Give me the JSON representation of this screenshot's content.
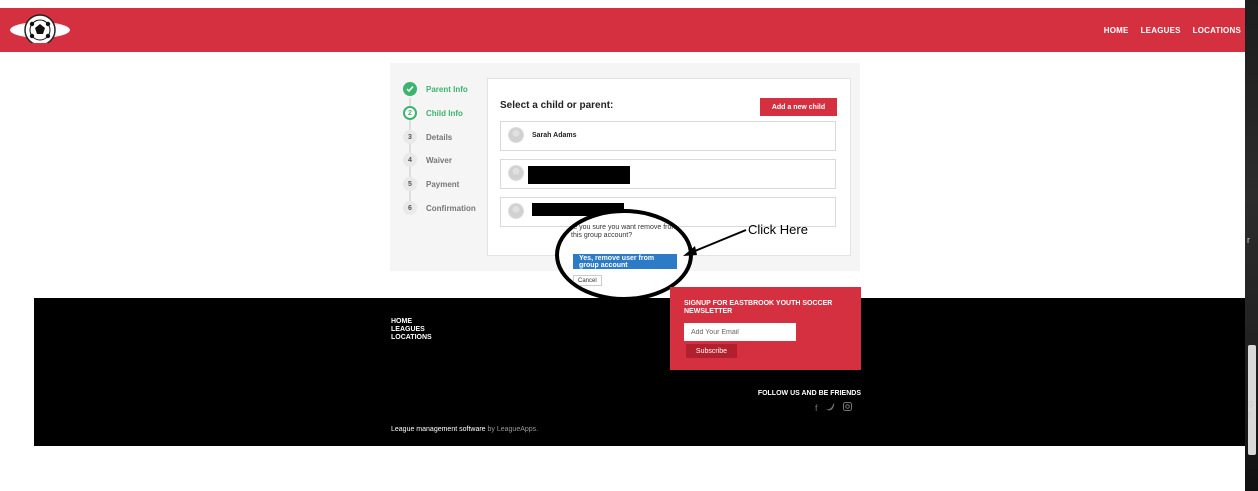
{
  "header": {
    "nav": [
      "HOME",
      "LEAGUES",
      "LOCATIONS"
    ],
    "brand_color": "#d4303f"
  },
  "steps": [
    {
      "num": "",
      "label": "Parent Info",
      "state": "done"
    },
    {
      "num": "2",
      "label": "Child Info",
      "state": "active"
    },
    {
      "num": "3",
      "label": "Details",
      "state": "todo"
    },
    {
      "num": "4",
      "label": "Waiver",
      "state": "todo"
    },
    {
      "num": "5",
      "label": "Payment",
      "state": "todo"
    },
    {
      "num": "6",
      "label": "Confirmation",
      "state": "todo"
    }
  ],
  "card": {
    "title": "Select a child or parent:",
    "add_button": "Add a new child",
    "rows": [
      {
        "name": "Sarah Adams",
        "redacted": false
      },
      {
        "name": "",
        "redacted": true
      },
      {
        "name": "",
        "redacted": true
      }
    ]
  },
  "dialog": {
    "text": "re you sure you want remove from this group account?",
    "confirm": "Yes, remove user from group account",
    "cancel": "Cancel"
  },
  "annotation": "Click Here",
  "footer": {
    "nav": [
      "HOME",
      "LEAGUES",
      "LOCATIONS"
    ],
    "newsletter_title": "SIGNUP FOR EASTBROOK YOUTH SOCCER NEWSLETTER",
    "email_placeholder": "Add Your Email",
    "subscribe": "Subscribe",
    "follow": "FOLLOW US AND BE FRIENDS",
    "social_icons": [
      "facebook-icon",
      "twitter-icon",
      "instagram-icon"
    ],
    "credit_text": "League management software",
    "credit_by": "by LeagueApps."
  }
}
